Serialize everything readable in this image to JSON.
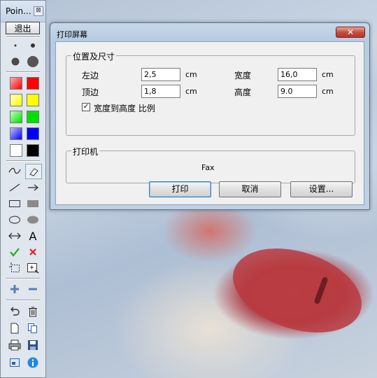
{
  "toolbar": {
    "title": "Poin...",
    "close_glyph": "⊠",
    "exit_label": "退出",
    "colors": {
      "red": "#ff0000",
      "yellow": "#ffff00",
      "green": "#00e000",
      "blue": "#0000ff",
      "white": "#ffffff",
      "black": "#000000"
    },
    "text_tool_label": "A",
    "icons": [
      "dot-small-icon",
      "dot-medium-icon",
      "dot-large-icon",
      "dot-xlarge-icon",
      "freehand-icon",
      "eraser-icon",
      "line-icon",
      "arrow-icon",
      "rectangle-icon",
      "filled-rectangle-icon",
      "ellipse-icon",
      "filled-ellipse-icon",
      "double-arrow-icon",
      "text-icon",
      "check-icon",
      "cross-icon",
      "select-region-icon",
      "zoom-region-icon",
      "plus-icon",
      "minus-icon",
      "undo-icon",
      "trash-icon",
      "new-page-icon",
      "copy-icon",
      "print-icon",
      "save-icon",
      "screen-icon",
      "info-icon"
    ]
  },
  "dialog": {
    "title": "打印屏幕",
    "close_label": "✕",
    "position_group": {
      "label": "位置及尺寸",
      "left_label": "左边",
      "left_value": "2,5",
      "top_label": "顶边",
      "top_value": "1,8",
      "width_label": "宽度",
      "width_value": "16,0",
      "height_label": "高度",
      "height_value": "9.0",
      "unit": "cm",
      "ratio_label": "宽度到高度 比例",
      "ratio_checked": true
    },
    "printer_group": {
      "label": "打印机",
      "printer_name": "Fax"
    },
    "buttons": {
      "print": "打印",
      "cancel": "取消",
      "settings": "设置..."
    }
  }
}
